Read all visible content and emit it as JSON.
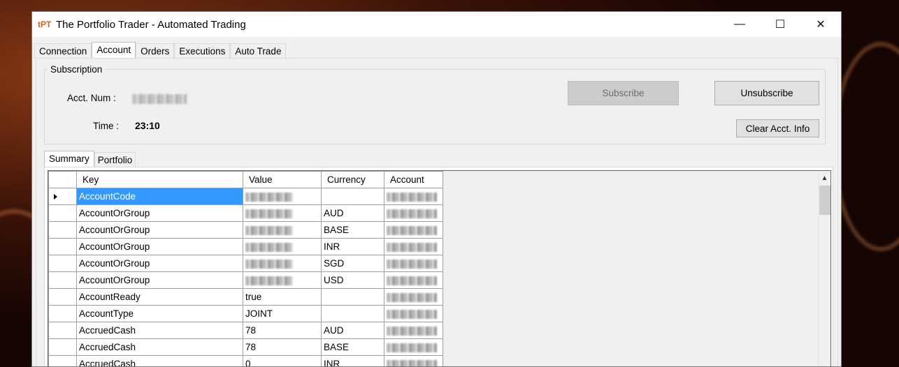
{
  "window": {
    "logo": "tPT",
    "title": "The Portfolio Trader - Automated Trading",
    "controls": {
      "minimize": "—",
      "maximize": "☐",
      "close": "✕"
    }
  },
  "tabs": [
    {
      "label": "Connection"
    },
    {
      "label": "Account",
      "active": true
    },
    {
      "label": "Orders"
    },
    {
      "label": "Executions"
    },
    {
      "label": "Auto Trade"
    }
  ],
  "subscription": {
    "legend": "Subscription",
    "acct_num_label": "Acct. Num :",
    "time_label": "Time :",
    "time_value": "23:10",
    "subscribe_label": "Subscribe",
    "unsubscribe_label": "Unsubscribe",
    "clear_label": "Clear Acct. Info"
  },
  "subtabs": [
    {
      "label": "Summary",
      "active": true
    },
    {
      "label": "Portfolio"
    }
  ],
  "grid": {
    "columns": [
      "Key",
      "Value",
      "Currency",
      "Account"
    ],
    "rows": [
      {
        "key": "AccountCode",
        "value": "",
        "currency": "",
        "value_redacted": true,
        "selected": true
      },
      {
        "key": "AccountOrGroup",
        "value": "",
        "currency": "AUD",
        "value_redacted": true
      },
      {
        "key": "AccountOrGroup",
        "value": "",
        "currency": "BASE",
        "value_redacted": true
      },
      {
        "key": "AccountOrGroup",
        "value": "",
        "currency": "INR",
        "value_redacted": true
      },
      {
        "key": "AccountOrGroup",
        "value": "",
        "currency": "SGD",
        "value_redacted": true
      },
      {
        "key": "AccountOrGroup",
        "value": "",
        "currency": "USD",
        "value_redacted": true
      },
      {
        "key": "AccountReady",
        "value": "true",
        "currency": ""
      },
      {
        "key": "AccountType",
        "value": "JOINT",
        "currency": ""
      },
      {
        "key": "AccruedCash",
        "value": "78",
        "currency": "AUD"
      },
      {
        "key": "AccruedCash",
        "value": "78",
        "currency": "BASE"
      },
      {
        "key": "AccruedCash",
        "value": "0",
        "currency": "INR"
      }
    ]
  }
}
